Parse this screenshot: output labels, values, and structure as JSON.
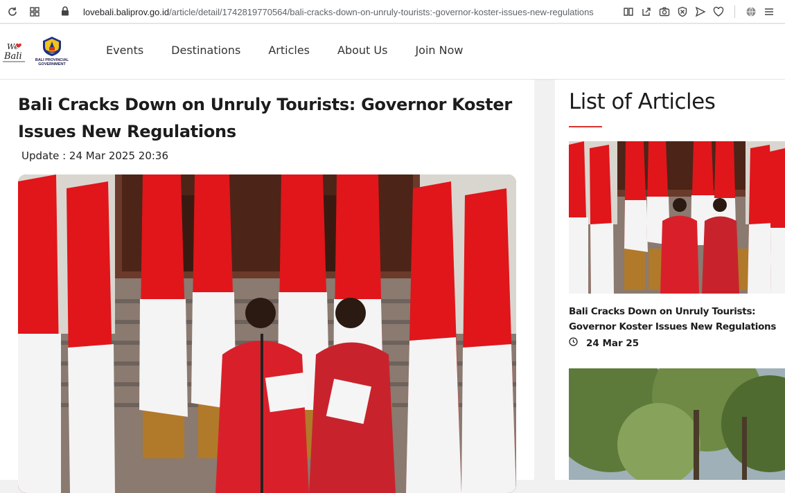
{
  "browser": {
    "url_domain": "lovebali.baliprov.go.id",
    "url_path": "/article/detail/1742819770564/bali-cracks-down-on-unruly-tourists:-governor-koster-issues-new-regulations"
  },
  "logos": {
    "welovebali_line1": "We",
    "welovebali_line2": "Bali",
    "gov_label_line1": "BALI PROVINCIAL",
    "gov_label_line2": "GOVERNMENT"
  },
  "nav": {
    "items": [
      {
        "label": "Events"
      },
      {
        "label": "Destinations"
      },
      {
        "label": "Articles"
      },
      {
        "label": "About Us"
      },
      {
        "label": "Join Now"
      }
    ]
  },
  "article": {
    "title": "Bali Cracks Down on Unruly Tourists: Governor Koster Issues New Regulations",
    "update": "Update : 24 Mar 2025 20:36"
  },
  "sidebar": {
    "title": "List of Articles",
    "items": [
      {
        "title": "Bali Cracks Down on Unruly Tourists: Governor Koster Issues New Regulations",
        "date": "24 Mar 25"
      }
    ]
  },
  "colors": {
    "accent_red": "#d9302c",
    "flag_red": "#e0161b",
    "flag_white": "#f4f4f4"
  }
}
